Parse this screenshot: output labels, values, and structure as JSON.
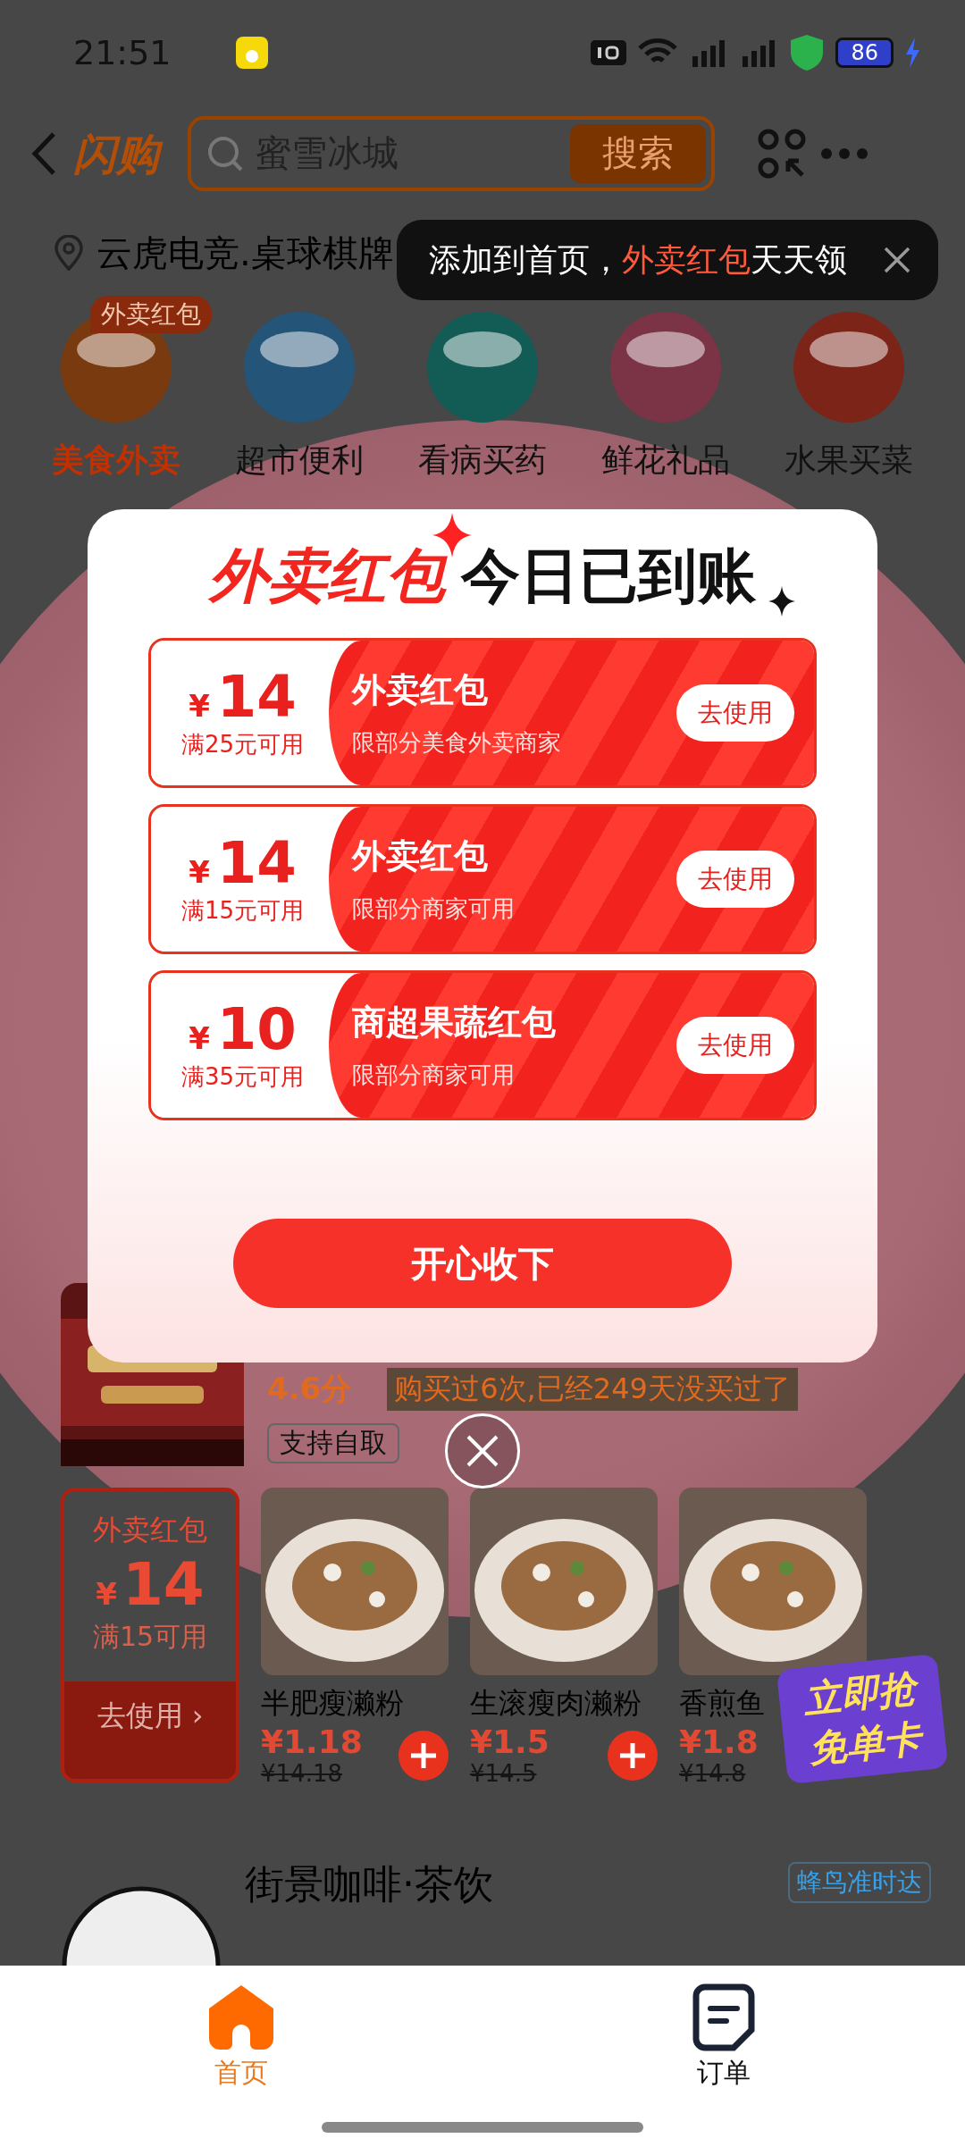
{
  "status_bar": {
    "time": "21:51",
    "battery": "86"
  },
  "header": {
    "logo": "闪购",
    "search": {
      "placeholder": "蜜雪冰城"
    },
    "search_button": "搜索"
  },
  "location": {
    "address": "云虎电竞.桌球棋牌"
  },
  "tooltip": {
    "prefix": "添加到首页，",
    "highlight": "外卖红包",
    "suffix": "天天领"
  },
  "categories": [
    {
      "label": "美食外卖",
      "selected": true,
      "badge": "外卖红包"
    },
    {
      "label": "超市便利",
      "selected": false
    },
    {
      "label": "看病买药",
      "selected": false
    },
    {
      "label": "鲜花礼品",
      "selected": false
    },
    {
      "label": "水果买菜",
      "selected": false
    }
  ],
  "store": {
    "rating": "4.6分",
    "history": "购买过6次,已经249天没买过了",
    "tag": "支持自取",
    "coupon": {
      "title": "外卖红包",
      "currency": "¥",
      "amount": "14",
      "condition": "满15可用",
      "button": "去使用 ›"
    },
    "dishes": [
      {
        "name": "半肥瘦濑粉",
        "price": "¥1.18",
        "original_price": "¥14.18"
      },
      {
        "name": "生滚瘦肉濑粉",
        "price": "¥1.5",
        "original_price": "¥14.5"
      },
      {
        "name": "香煎鱼",
        "price": "¥1.8",
        "original_price": "¥14.8"
      }
    ]
  },
  "promo_badge": {
    "line_1": "立即抢",
    "line_2": "免单卡"
  },
  "next_store": {
    "name": "街景咖啡·茶饮",
    "tag": "蜂鸟准时达"
  },
  "modal": {
    "title_highlight": "外卖红包",
    "title": "今日已到账",
    "coupons": [
      {
        "currency": "¥",
        "amount": "14",
        "condition": "满25元可用",
        "name": "外卖红包",
        "scope": "限部分美食外卖商家",
        "button": "去使用"
      },
      {
        "currency": "¥",
        "amount": "14",
        "condition": "满15元可用",
        "name": "外卖红包",
        "scope": "限部分商家可用",
        "button": "去使用"
      },
      {
        "currency": "¥",
        "amount": "10",
        "condition": "满35元可用",
        "name": "商超果蔬红包",
        "scope": "限部分商家可用",
        "button": "去使用"
      }
    ],
    "accept_button": "开心收下"
  },
  "bottom_nav": [
    {
      "label": "首页",
      "selected": true
    },
    {
      "label": "订单",
      "selected": false
    }
  ]
}
